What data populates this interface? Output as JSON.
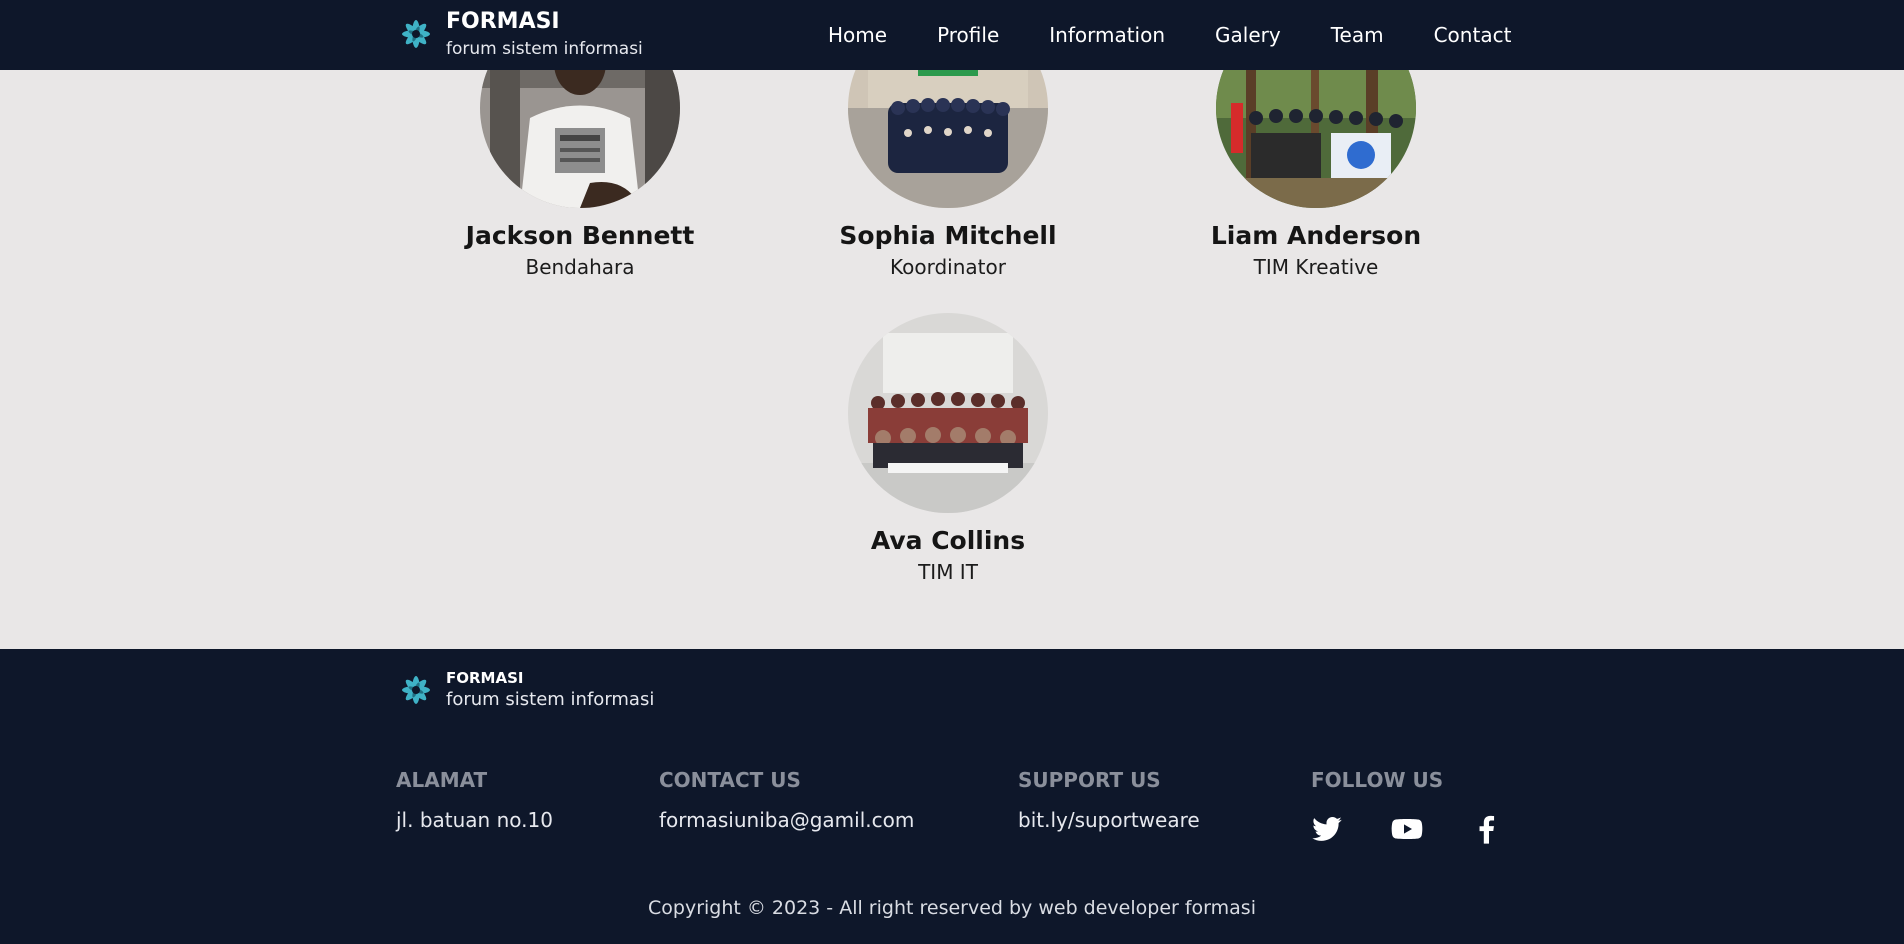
{
  "header": {
    "brand_title": "FORMASI",
    "brand_subtitle": "forum sistem informasi",
    "nav": [
      "Home",
      "Profile",
      "Information",
      "Galery",
      "Team",
      "Contact"
    ]
  },
  "team": [
    {
      "name": "Jackson Bennett",
      "role": "Bendahara"
    },
    {
      "name": "Sophia Mitchell",
      "role": "Koordinator"
    },
    {
      "name": "Liam Anderson",
      "role": "TIM Kreative"
    },
    {
      "name": "Ava Collins",
      "role": "TIM IT"
    }
  ],
  "footer": {
    "brand_title": "FORMASI",
    "brand_subtitle": "forum sistem informasi",
    "columns": [
      {
        "heading": "ALAMAT",
        "value": "jl. batuan no.10"
      },
      {
        "heading": "CONTACT US",
        "value": "formasiuniba@gamil.com"
      },
      {
        "heading": "SUPPORT US",
        "value": "bit.ly/suportweare"
      },
      {
        "heading": "FOLLOW US"
      }
    ],
    "socials": [
      "twitter-icon",
      "youtube-icon",
      "facebook-icon"
    ],
    "copyright": "Copyright © 2023 - All right reserved by web developer formasi"
  },
  "colors": {
    "header_bg": "#0e172a",
    "page_bg": "#e9e7e7",
    "logo_accent": "#3fb2c6"
  }
}
